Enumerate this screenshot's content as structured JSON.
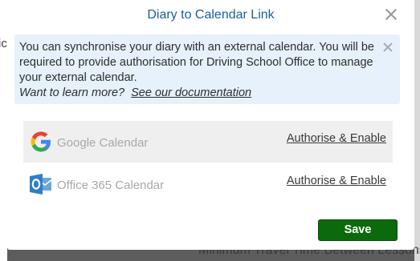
{
  "background": {
    "left_fragment": "ic",
    "bottom_text": "Minimum Travel Time Between Lessons"
  },
  "modal": {
    "title": "Diary to Calendar Link",
    "close_icon": "close-icon",
    "info": {
      "text": "You can synchronise your diary with an external calendar. You will be required to provide authorisation for Driving School Office to manage your external calendar.",
      "learn_prompt": "Want to learn more?",
      "doc_link": "See our documentation",
      "close_icon": "close-icon"
    },
    "calendars": [
      {
        "name": "Google Calendar",
        "action": "Authorise & Enable",
        "icon": "google-icon"
      },
      {
        "name": "Office 365 Calendar",
        "action": "Authorise & Enable",
        "icon": "office365-icon"
      }
    ],
    "save_label": "Save"
  },
  "colors": {
    "title": "#1a5e9c",
    "info_background": "#e6f1fb",
    "save_button": "#0b6a0b",
    "overlay": "#5d5d5d"
  }
}
